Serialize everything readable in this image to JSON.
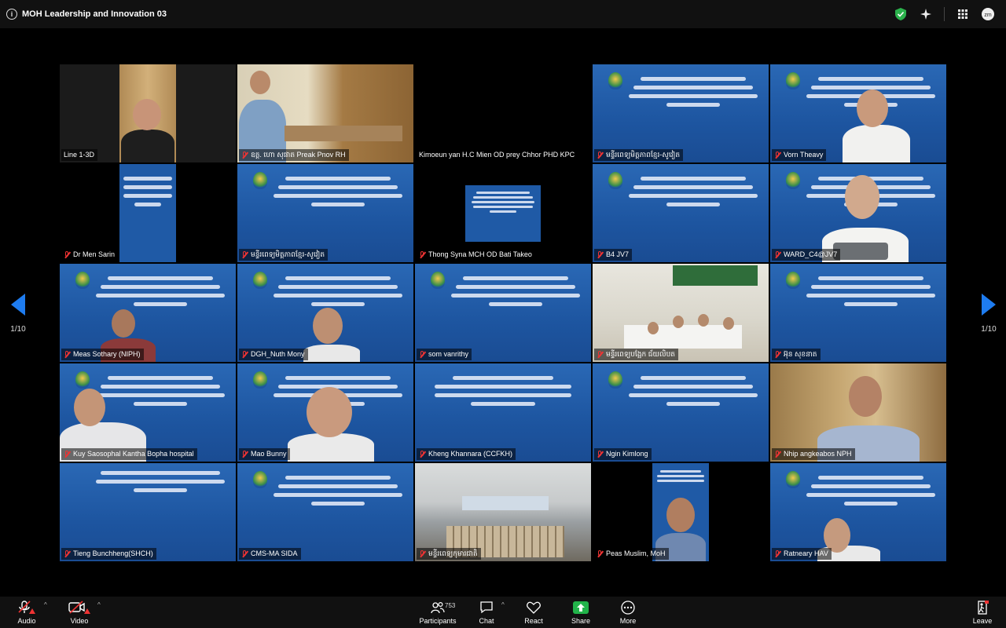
{
  "window": {
    "title": "MOH Leadership and Innovation 03"
  },
  "pager": {
    "left_page": "1/10",
    "right_page": "1/10"
  },
  "slide_text": "ការបណ្តុះបណ្តាលអំពី ភាពជាអ្នកដឹកនាំ និងនវានុវត្តន៍ សម្រាប់ព្រឹទ្ធអង្គភាពសុខាភិបាល ឆ្នាំ ២០២៦",
  "tiles": [
    {
      "name": "Line 1-3D"
    },
    {
      "name": "ឧត្ត. ហោ សុផាត Preak Pnov RH"
    },
    {
      "name": "Kimoeun yan H.C Mien OD prey Chhor PHD KPC"
    },
    {
      "name": "មន្ទីរពេទ្យមិត្តភាពខ្មែរ-សូវៀត"
    },
    {
      "name": "Vorn Theavy"
    },
    {
      "name": "Dr Men Sarin"
    },
    {
      "name": "មន្ទីរពេទ្យមិត្តភាពខ្មែរ-សូវៀត"
    },
    {
      "name": "Thong Syna MCH OD Bati Takeo"
    },
    {
      "name": "B4 JV7"
    },
    {
      "name": "WARD_C4@JV7"
    },
    {
      "name": "Meas Sothary (NIPH)"
    },
    {
      "name": "DGH_Nuth Mony"
    },
    {
      "name": "som vanrithy"
    },
    {
      "name": "មន្ទីរពេទ្យបង្អែក ជ័យលិបត"
    },
    {
      "name": "អ៊ុន សុខនាត"
    },
    {
      "name": "Kuy Saosophal Kantha Bopha hospital"
    },
    {
      "name": "Mao Bunny"
    },
    {
      "name": "Kheng Khannara (CCFKH)"
    },
    {
      "name": "Ngin Kimlong"
    },
    {
      "name": "Nhip angkeabos NPH"
    },
    {
      "name": "Tieng Bunchheng(SHCH)"
    },
    {
      "name": "CMS-MA SIDA"
    },
    {
      "name": "មន្ទីរពេទ្យកុមារជាតិ"
    },
    {
      "name": "Peas Muslim, MoH"
    },
    {
      "name": "Ratneary HAV"
    }
  ],
  "toolbar": {
    "audio": "Audio",
    "video": "Video",
    "participants": "Participants",
    "participants_count": "753",
    "chat": "Chat",
    "react": "React",
    "share": "Share",
    "more": "More",
    "leave": "Leave"
  },
  "colors": {
    "accent_blue": "#1e7cf0",
    "active_speaker": "#4fd04f",
    "share_green": "#22b34a",
    "mute_red": "#e33333",
    "slide_blue": "#1f5aa6"
  }
}
